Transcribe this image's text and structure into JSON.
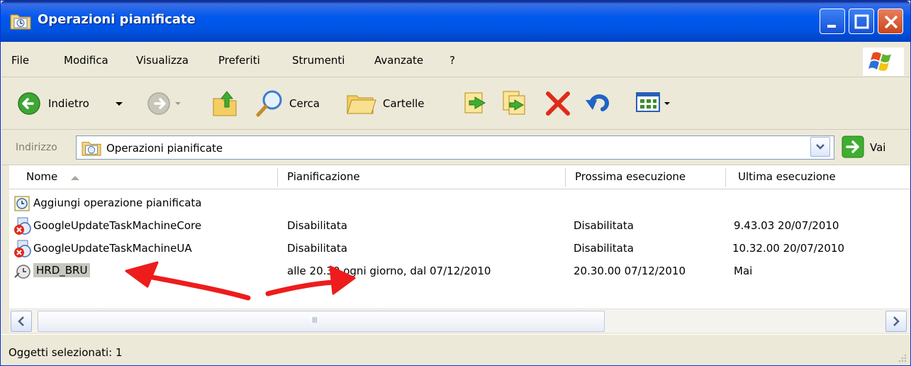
{
  "window": {
    "title": "Operazioni pianificate",
    "accent_color": "#0054e3"
  },
  "menu": [
    "File",
    "Modifica",
    "Visualizza",
    "Preferiti",
    "Strumenti",
    "Avanzate",
    "?"
  ],
  "toolbar": {
    "back_label": "Indietro",
    "search_label": "Cerca",
    "folders_label": "Cartelle"
  },
  "address": {
    "label": "Indirizzo",
    "value": "Operazioni pianificate",
    "go_label": "Vai"
  },
  "list": {
    "columns": [
      "Nome",
      "Pianificazione",
      "Prossima esecuzione",
      "Ultima esecuzione"
    ],
    "rows": [
      {
        "name": "Aggiungi operazione pianificata",
        "schedule": "",
        "next": "",
        "last": "",
        "icon": "add-task-icon"
      },
      {
        "name": "GoogleUpdateTaskMachineCore",
        "schedule": "Disabilitata",
        "next": "Disabilitata",
        "last": "9.43.03  20/07/2010",
        "icon": "disabled-task-icon"
      },
      {
        "name": "GoogleUpdateTaskMachineUA",
        "schedule": "Disabilitata",
        "next": "Disabilitata",
        "last": "10.32.00  20/07/2010",
        "icon": "disabled-task-icon"
      },
      {
        "name": "HRD_BRU",
        "schedule": "alle 20.30 ogni giorno, dal 07/12/2010",
        "next": "20.30.00  07/12/2010",
        "last": "Mai",
        "icon": "scheduled-task-icon"
      }
    ]
  },
  "scrollbar": {
    "grip": "III"
  },
  "status": {
    "text": "Oggetti selezionati: 1"
  },
  "annotation_color": "#ee1c1c"
}
